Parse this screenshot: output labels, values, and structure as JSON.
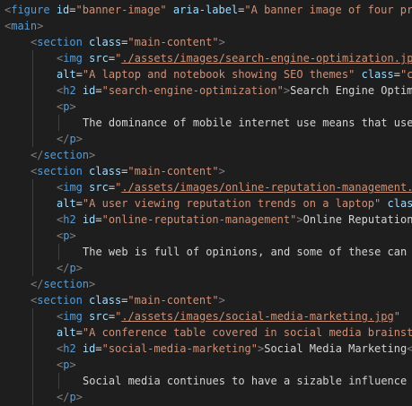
{
  "theme": {
    "background": "#1e1e1e",
    "tag_color": "#569cd6",
    "attribute_color": "#9cdcfe",
    "string_color": "#ce9178",
    "text_color": "#d4d4d4",
    "bracket_color": "#808080"
  },
  "code_lines": [
    {
      "indent": 0,
      "tokens": [
        {
          "k": "punct",
          "t": "<"
        },
        {
          "k": "tag",
          "t": "figure"
        },
        {
          "k": "text",
          "t": " "
        },
        {
          "k": "attr",
          "t": "id"
        },
        {
          "k": "eq",
          "t": "="
        },
        {
          "k": "str",
          "t": "\"banner-image\""
        },
        {
          "k": "text",
          "t": " "
        },
        {
          "k": "attr",
          "t": "aria-label"
        },
        {
          "k": "eq",
          "t": "="
        },
        {
          "k": "str",
          "t": "\"A banner image of four pr"
        }
      ]
    },
    {
      "indent": 0,
      "tokens": [
        {
          "k": "punct",
          "t": "<"
        },
        {
          "k": "tag",
          "t": "main"
        },
        {
          "k": "punct",
          "t": ">"
        }
      ]
    },
    {
      "indent": 1,
      "tokens": [
        {
          "k": "punct",
          "t": "<"
        },
        {
          "k": "tag",
          "t": "section"
        },
        {
          "k": "text",
          "t": " "
        },
        {
          "k": "attr",
          "t": "class"
        },
        {
          "k": "eq",
          "t": "="
        },
        {
          "k": "str",
          "t": "\"main-content\""
        },
        {
          "k": "punct",
          "t": ">"
        }
      ]
    },
    {
      "indent": 2,
      "tokens": [
        {
          "k": "punct",
          "t": "<"
        },
        {
          "k": "tag",
          "t": "img"
        },
        {
          "k": "text",
          "t": " "
        },
        {
          "k": "attr",
          "t": "src"
        },
        {
          "k": "eq",
          "t": "="
        },
        {
          "k": "str",
          "t": "\""
        },
        {
          "k": "link",
          "t": "./assets/images/search-engine-optimization.jp"
        }
      ]
    },
    {
      "indent": 2,
      "tokens": [
        {
          "k": "attr",
          "t": "alt"
        },
        {
          "k": "eq",
          "t": "="
        },
        {
          "k": "str",
          "t": "\"A laptop and notebook showing SEO themes\""
        },
        {
          "k": "text",
          "t": " "
        },
        {
          "k": "attr",
          "t": "class"
        },
        {
          "k": "eq",
          "t": "="
        },
        {
          "k": "str",
          "t": "\"c"
        }
      ]
    },
    {
      "indent": 2,
      "tokens": [
        {
          "k": "punct",
          "t": "<"
        },
        {
          "k": "tag",
          "t": "h2"
        },
        {
          "k": "text",
          "t": " "
        },
        {
          "k": "attr",
          "t": "id"
        },
        {
          "k": "eq",
          "t": "="
        },
        {
          "k": "str",
          "t": "\"search-engine-optimization\""
        },
        {
          "k": "punct",
          "t": ">"
        },
        {
          "k": "text",
          "t": "Search Engine Optim"
        }
      ]
    },
    {
      "indent": 2,
      "tokens": [
        {
          "k": "punct",
          "t": "<"
        },
        {
          "k": "tag",
          "t": "p"
        },
        {
          "k": "punct",
          "t": ">"
        }
      ]
    },
    {
      "indent": 3,
      "tokens": [
        {
          "k": "text",
          "t": "The dominance of mobile internet use means that use"
        }
      ]
    },
    {
      "indent": 2,
      "tokens": [
        {
          "k": "punct",
          "t": "</"
        },
        {
          "k": "tag",
          "t": "p"
        },
        {
          "k": "punct",
          "t": ">"
        }
      ]
    },
    {
      "indent": 1,
      "tokens": [
        {
          "k": "punct",
          "t": "</"
        },
        {
          "k": "tag",
          "t": "section"
        },
        {
          "k": "punct",
          "t": ">"
        }
      ]
    },
    {
      "indent": 1,
      "tokens": [
        {
          "k": "punct",
          "t": "<"
        },
        {
          "k": "tag",
          "t": "section"
        },
        {
          "k": "text",
          "t": " "
        },
        {
          "k": "attr",
          "t": "class"
        },
        {
          "k": "eq",
          "t": "="
        },
        {
          "k": "str",
          "t": "\"main-content\""
        },
        {
          "k": "punct",
          "t": ">"
        }
      ]
    },
    {
      "indent": 2,
      "tokens": [
        {
          "k": "punct",
          "t": "<"
        },
        {
          "k": "tag",
          "t": "img"
        },
        {
          "k": "text",
          "t": " "
        },
        {
          "k": "attr",
          "t": "src"
        },
        {
          "k": "eq",
          "t": "="
        },
        {
          "k": "str",
          "t": "\""
        },
        {
          "k": "link",
          "t": "./assets/images/online-reputation-management."
        }
      ]
    },
    {
      "indent": 2,
      "tokens": [
        {
          "k": "attr",
          "t": "alt"
        },
        {
          "k": "eq",
          "t": "="
        },
        {
          "k": "str",
          "t": "\"A user viewing reputation trends on a laptop\""
        },
        {
          "k": "text",
          "t": " "
        },
        {
          "k": "attr",
          "t": "clas"
        }
      ]
    },
    {
      "indent": 2,
      "tokens": [
        {
          "k": "punct",
          "t": "<"
        },
        {
          "k": "tag",
          "t": "h2"
        },
        {
          "k": "text",
          "t": " "
        },
        {
          "k": "attr",
          "t": "id"
        },
        {
          "k": "eq",
          "t": "="
        },
        {
          "k": "str",
          "t": "\"online-reputation-management\""
        },
        {
          "k": "punct",
          "t": ">"
        },
        {
          "k": "text",
          "t": "Online Reputation"
        }
      ]
    },
    {
      "indent": 2,
      "tokens": [
        {
          "k": "punct",
          "t": "<"
        },
        {
          "k": "tag",
          "t": "p"
        },
        {
          "k": "punct",
          "t": ">"
        }
      ]
    },
    {
      "indent": 3,
      "tokens": [
        {
          "k": "text",
          "t": "The web is full of opinions, and some of these can"
        }
      ]
    },
    {
      "indent": 2,
      "tokens": [
        {
          "k": "punct",
          "t": "</"
        },
        {
          "k": "tag",
          "t": "p"
        },
        {
          "k": "punct",
          "t": ">"
        }
      ]
    },
    {
      "indent": 1,
      "tokens": [
        {
          "k": "punct",
          "t": "</"
        },
        {
          "k": "tag",
          "t": "section"
        },
        {
          "k": "punct",
          "t": ">"
        }
      ]
    },
    {
      "indent": 1,
      "tokens": [
        {
          "k": "punct",
          "t": "<"
        },
        {
          "k": "tag",
          "t": "section"
        },
        {
          "k": "text",
          "t": " "
        },
        {
          "k": "attr",
          "t": "class"
        },
        {
          "k": "eq",
          "t": "="
        },
        {
          "k": "str",
          "t": "\"main-content\""
        },
        {
          "k": "punct",
          "t": ">"
        }
      ]
    },
    {
      "indent": 2,
      "tokens": [
        {
          "k": "punct",
          "t": "<"
        },
        {
          "k": "tag",
          "t": "img"
        },
        {
          "k": "text",
          "t": " "
        },
        {
          "k": "attr",
          "t": "src"
        },
        {
          "k": "eq",
          "t": "="
        },
        {
          "k": "str",
          "t": "\""
        },
        {
          "k": "link",
          "t": "./assets/images/social-media-marketing.jpg"
        },
        {
          "k": "str",
          "t": "\""
        }
      ]
    },
    {
      "indent": 2,
      "tokens": [
        {
          "k": "attr",
          "t": "alt"
        },
        {
          "k": "eq",
          "t": "="
        },
        {
          "k": "str",
          "t": "\"A conference table covered in social media brainst"
        }
      ]
    },
    {
      "indent": 2,
      "tokens": [
        {
          "k": "punct",
          "t": "<"
        },
        {
          "k": "tag",
          "t": "h2"
        },
        {
          "k": "text",
          "t": " "
        },
        {
          "k": "attr",
          "t": "id"
        },
        {
          "k": "eq",
          "t": "="
        },
        {
          "k": "str",
          "t": "\"social-media-marketing\""
        },
        {
          "k": "punct",
          "t": ">"
        },
        {
          "k": "text",
          "t": "Social Media Marketing"
        },
        {
          "k": "punct",
          "t": "<"
        }
      ]
    },
    {
      "indent": 2,
      "tokens": [
        {
          "k": "punct",
          "t": "<"
        },
        {
          "k": "tag",
          "t": "p"
        },
        {
          "k": "punct",
          "t": ">"
        }
      ]
    },
    {
      "indent": 3,
      "tokens": [
        {
          "k": "text",
          "t": "Social media continues to have a sizable influence"
        }
      ]
    },
    {
      "indent": 2,
      "tokens": [
        {
          "k": "punct",
          "t": "</"
        },
        {
          "k": "tag",
          "t": "p"
        },
        {
          "k": "punct",
          "t": ">"
        }
      ]
    }
  ]
}
